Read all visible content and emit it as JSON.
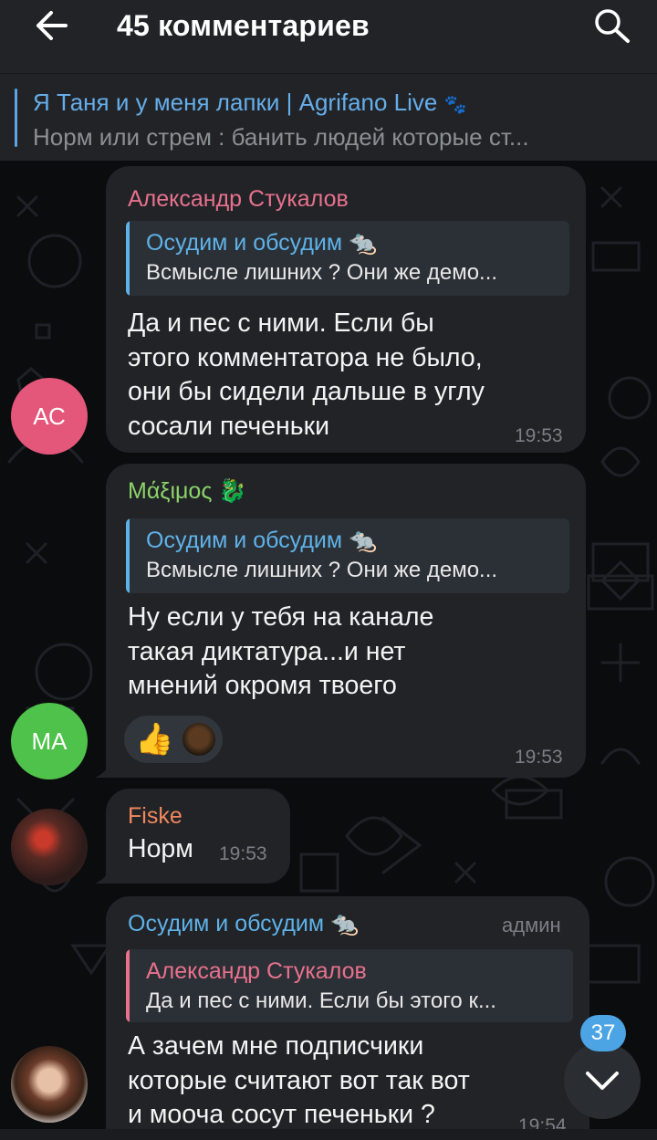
{
  "header": {
    "title": "45 комментариев",
    "back_icon": "arrow-left-icon",
    "search_icon": "search-icon"
  },
  "pinned": {
    "title": "Я Таня и у меня лапки | Agrifano Live",
    "title_icon": "paw-prints-icon",
    "text": "Норм или стрем : банить людей которые ст..."
  },
  "messages": [
    {
      "sender": "Александр Стукалов",
      "sender_color": "#e8718d",
      "avatar_initials": "АС",
      "avatar_color": "#e5577a",
      "reply": {
        "name": "Осудим и обсудим 🐀",
        "text": "Всмысле лишних ? Они же демо..."
      },
      "lines": [
        "Да и пес с ними. Если бы",
        "этого комментатора не было,",
        "они бы сидели дальше в углу",
        "сосали печеньки"
      ],
      "time": "19:53"
    },
    {
      "sender": "Μάξιμος 🐉",
      "sender_color": "#8cd36a",
      "avatar_initials": "МА",
      "avatar_color": "#4fc24b",
      "reply": {
        "name": "Осудим и обсудим 🐀",
        "text": "Всмысле лишних ? Они же демо..."
      },
      "lines": [
        "Ну если у тебя на канале",
        "такая диктатура...и нет",
        "мнений окромя твоего"
      ],
      "reactions": [
        "👍"
      ],
      "time": "19:53"
    },
    {
      "sender": "Fiske",
      "sender_color": "#f0885e",
      "lines": [
        "Норм"
      ],
      "time": "19:53"
    },
    {
      "sender": "Осудим и обсудим 🐀",
      "sender_color": "#5fb2e8",
      "role": "админ",
      "reply": {
        "name": "Александр Стукалов",
        "text": "Да и пес с ними. Если бы этого к..."
      },
      "lines": [
        "А зачем мне подписчики",
        "которые считают вот так вот",
        "и мооча сосут печеньки ?"
      ],
      "time": "19:54"
    }
  ],
  "unread_badge": "37",
  "scroll_down_icon": "chevron-down-icon",
  "colors": {
    "accent": "#4ca4e5",
    "bubble": "#212327",
    "header": "#212327"
  }
}
